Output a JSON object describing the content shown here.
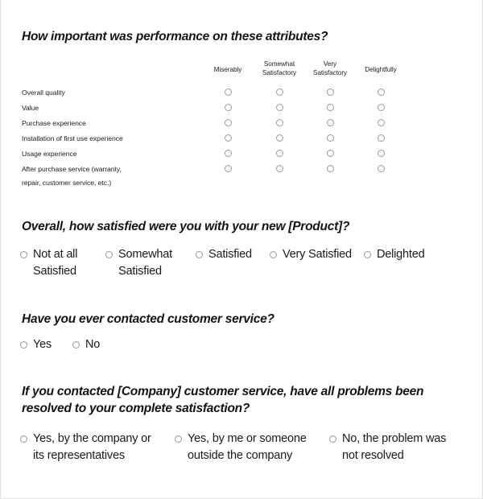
{
  "sections": [
    {
      "heading": "How important was performance on these attributes?",
      "columns": [
        {
          "line1": "Miserably",
          "line2": ""
        },
        {
          "line1": "Somewhat",
          "line2": "Satisfactory"
        },
        {
          "line1": "Very",
          "line2": "Satisfactory"
        },
        {
          "line1": "Delightfully",
          "line2": ""
        }
      ],
      "rows": [
        {
          "line1": "Overall quality",
          "line2": ""
        },
        {
          "line1": "Value",
          "line2": ""
        },
        {
          "line1": "Purchase experience",
          "line2": ""
        },
        {
          "line1": "Installation of first use experience",
          "line2": ""
        },
        {
          "line1": "Usage experience",
          "line2": ""
        },
        {
          "line1": "After purchase service (warranty,",
          "line2": "repair, customer service, etc.)"
        }
      ]
    },
    {
      "heading": "Overall, how satisfied were you with your new [Product]?",
      "options": [
        {
          "line1": "Not at all",
          "line2": "Satisfied"
        },
        {
          "line1": "Somewhat",
          "line2": "Satisfied"
        },
        {
          "line1": "Satisfied",
          "line2": ""
        },
        {
          "line1": "Very Satisfied",
          "line2": ""
        },
        {
          "line1": "Delighted",
          "line2": ""
        }
      ]
    },
    {
      "heading": "Have you ever contacted customer service?",
      "options": [
        {
          "line1": "Yes",
          "line2": ""
        },
        {
          "line1": "No",
          "line2": ""
        }
      ]
    },
    {
      "heading": "If you contacted [Company] customer service, have all problems been resolved to your complete satisfaction?",
      "options": [
        {
          "line1": "Yes, by the company or",
          "line2": "its representatives"
        },
        {
          "line1": "Yes, by me or someone",
          "line2": "outside the company"
        },
        {
          "line1": "No, the problem was",
          "line2": "not resolved"
        }
      ]
    }
  ],
  "colors": {
    "radio_border": "#9a9a9a",
    "text": "#1a1a1a",
    "page_border": "#e3e3e3"
  }
}
